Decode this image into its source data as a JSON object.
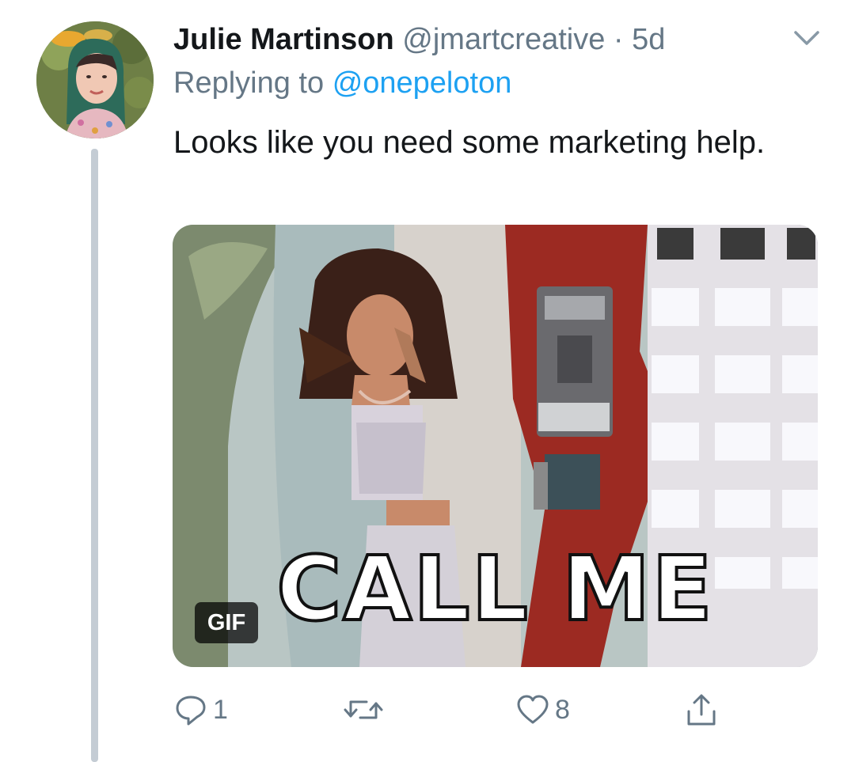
{
  "tweet": {
    "author_name": "Julie Martinson",
    "author_handle": "@jmartcreative",
    "separator": "·",
    "timestamp": "5d",
    "replying_prefix": "Replying to",
    "replying_to": "@onepeloton",
    "text": "Looks like you need some marketing help.",
    "media": {
      "caption": "CALL ME",
      "badge": "GIF"
    },
    "actions": {
      "reply_count": "1",
      "like_count": "8"
    }
  },
  "icons": [
    "chevron-down-icon",
    "reply-icon",
    "retweet-icon",
    "like-icon",
    "share-icon"
  ],
  "colors": {
    "text": "#14171a",
    "secondary": "#657786",
    "link": "#1da1f2",
    "thread_line": "#c4ccd4"
  }
}
